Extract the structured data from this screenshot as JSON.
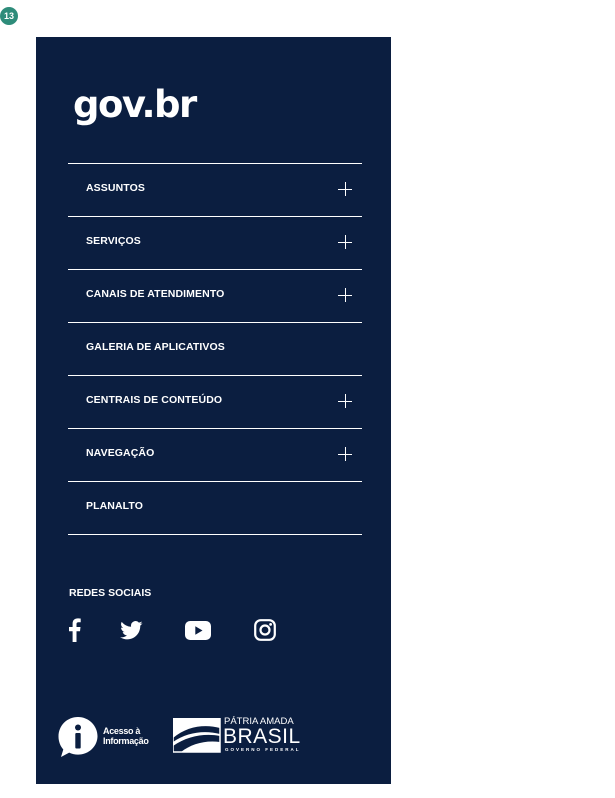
{
  "page": {
    "step_badge": "13"
  },
  "footer": {
    "logo_text": "gov.br",
    "menu": [
      {
        "label": "ASSUNTOS",
        "expandable": true
      },
      {
        "label": "SERVIÇOS",
        "expandable": true
      },
      {
        "label": "CANAIS DE ATENDIMENTO",
        "expandable": true
      },
      {
        "label": "GALERIA DE APLICATIVOS",
        "expandable": false
      },
      {
        "label": "CENTRAIS DE CONTEÚDO",
        "expandable": true
      },
      {
        "label": "NAVEGAÇÃO",
        "expandable": true
      },
      {
        "label": "PLANALTO",
        "expandable": false
      }
    ],
    "social_heading": "REDES SOCIAIS",
    "social_icons": [
      "facebook-icon",
      "twitter-icon",
      "youtube-icon",
      "instagram-icon"
    ],
    "access_info": {
      "line1": "Acesso à",
      "line2": "Informação"
    },
    "government_brand": {
      "line1": "PÁTRIA AMADA",
      "line2": "BRASIL",
      "line3": "GOVERNO FEDERAL"
    }
  },
  "colors": {
    "background": "#0b1e40",
    "text": "#ffffff",
    "badge": "#2e8c7a"
  }
}
